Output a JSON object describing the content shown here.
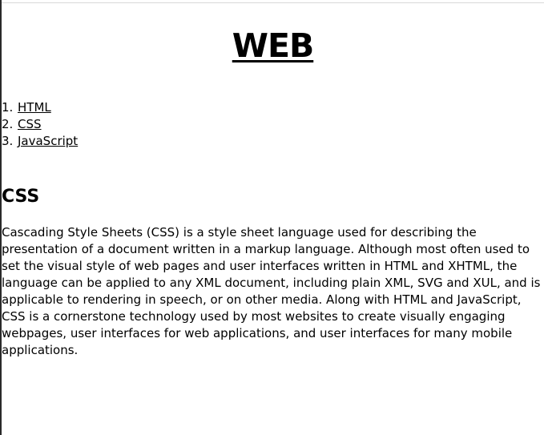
{
  "page": {
    "title": "WEB",
    "nav": [
      {
        "number": "1.",
        "label": "HTML"
      },
      {
        "number": "2.",
        "label": "CSS"
      },
      {
        "number": "3.",
        "label": "JavaScript"
      }
    ],
    "section_heading": "CSS",
    "article": "Cascading Style Sheets (CSS) is a style sheet language used for describing the presentation of a document written in a markup language. Although most often used to set the visual style of web pages and user interfaces written in HTML and XHTML, the language can be applied to any XML document, including plain XML, SVG and XUL, and is applicable to rendering in speech, or on other media. Along with HTML and JavaScript, CSS is a cornerstone technology used by most websites to create visually engaging webpages, user interfaces for web applications, and user interfaces for many mobile applications."
  }
}
